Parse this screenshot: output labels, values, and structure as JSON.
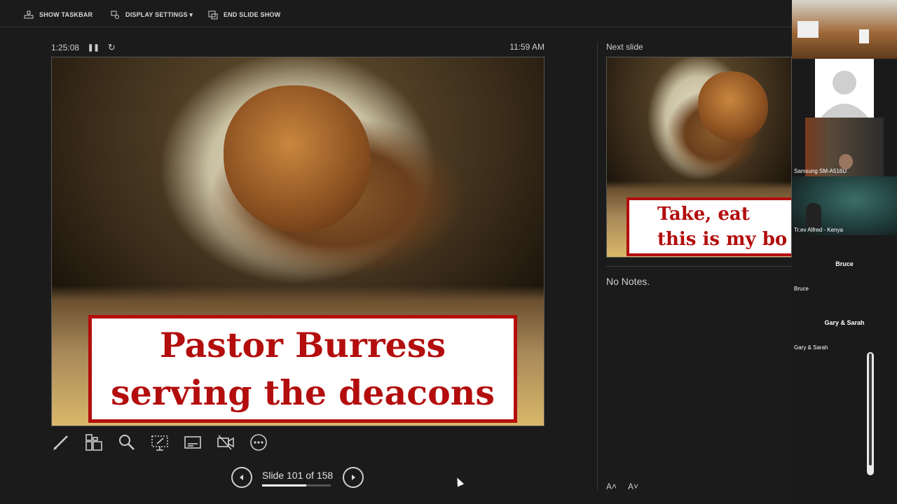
{
  "toolbar": {
    "show_taskbar": "SHOW TASKBAR",
    "display_settings": "DISPLAY SETTINGS ▾",
    "end_slide_show": "END SLIDE SHOW"
  },
  "presenter": {
    "elapsed": "1:25:08",
    "clock": "11:59 AM",
    "current_slide": {
      "line1": "Pastor Burress",
      "line2": "serving the deacons"
    },
    "slide_counter": "Slide 101 of 158",
    "progress": 0.639,
    "next_slide_label": "Next slide",
    "next_slide": {
      "line1": "Take, eat",
      "line2": "this is my bo"
    },
    "notes": "No Notes.",
    "font_increase": "A˄",
    "font_decrease": "A˅"
  },
  "participants": [
    {
      "name": ""
    },
    {
      "name": ""
    },
    {
      "name": "Samsung SM-A516U"
    },
    {
      "name": "Tr.ev Alfred  - Kenya"
    },
    {
      "name": "Bruce",
      "label": "Bruce"
    },
    {
      "name": "Gary & Sarah",
      "label": "Gary & Sarah"
    }
  ],
  "icons": [
    "taskbar-icon",
    "display-settings-icon",
    "end-show-icon",
    "pause-icon",
    "restart-icon",
    "pen-icon",
    "slides-grid-icon",
    "zoom-icon",
    "pointer-screen-icon",
    "subtitles-icon",
    "camera-off-icon",
    "more-icon",
    "prev-arrow-icon",
    "next-arrow-icon"
  ],
  "colors": {
    "background": "#1b1b1b",
    "caption_red": "#b30d0d"
  }
}
